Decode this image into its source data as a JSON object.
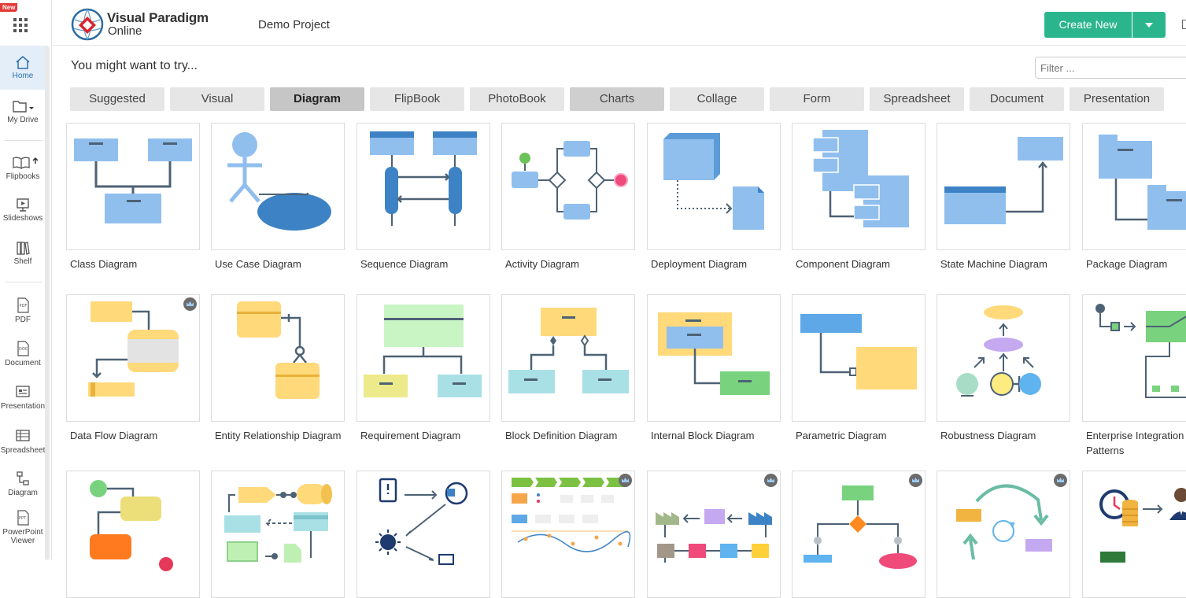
{
  "sidebar": {
    "badge": "New",
    "items": [
      {
        "label": "Home",
        "icon": "home-icon"
      },
      {
        "label": "My Drive",
        "icon": "folder-icon"
      },
      {
        "label": "Flipbooks",
        "icon": "book-icon"
      },
      {
        "label": "Slideshows",
        "icon": "slideshow-icon"
      },
      {
        "label": "Shelf",
        "icon": "shelf-icon"
      },
      {
        "label": "PDF",
        "icon": "pdf-icon"
      },
      {
        "label": "Document",
        "icon": "doc-icon"
      },
      {
        "label": "Presentation",
        "icon": "presentation-icon"
      },
      {
        "label": "Spreadsheet",
        "icon": "spreadsheet-icon"
      },
      {
        "label": "Diagram",
        "icon": "diagram-icon"
      },
      {
        "label": "PowerPoint Viewer",
        "icon": "ppt-icon"
      }
    ]
  },
  "header": {
    "logo_line1": "Visual Paradigm",
    "logo_line2": "Online",
    "project": "Demo Project",
    "create_label": "Create New"
  },
  "main": {
    "try_text": "You might want to try...",
    "filter_placeholder": "Filter ...",
    "tabs": [
      "Suggested",
      "Visual",
      "Diagram",
      "FlipBook",
      "PhotoBook",
      "Charts",
      "Collage",
      "Form",
      "Spreadsheet",
      "Document",
      "Presentation"
    ],
    "active_tab": "Diagram",
    "cards": [
      "Class Diagram",
      "Use Case Diagram",
      "Sequence Diagram",
      "Activity Diagram",
      "Deployment Diagram",
      "Component Diagram",
      "State Machine Diagram",
      "Package Diagram",
      "Data Flow Diagram",
      "Entity Relationship Diagram",
      "Requirement Diagram",
      "Block Definition Diagram",
      "Internal Block Diagram",
      "Parametric Diagram",
      "Robustness Diagram",
      "Enterprise Integration Patterns"
    ]
  },
  "colors": {
    "accent": "#2bb58c",
    "diagram_blue": "#90bfee",
    "tab_active": "#c6c6c6"
  }
}
